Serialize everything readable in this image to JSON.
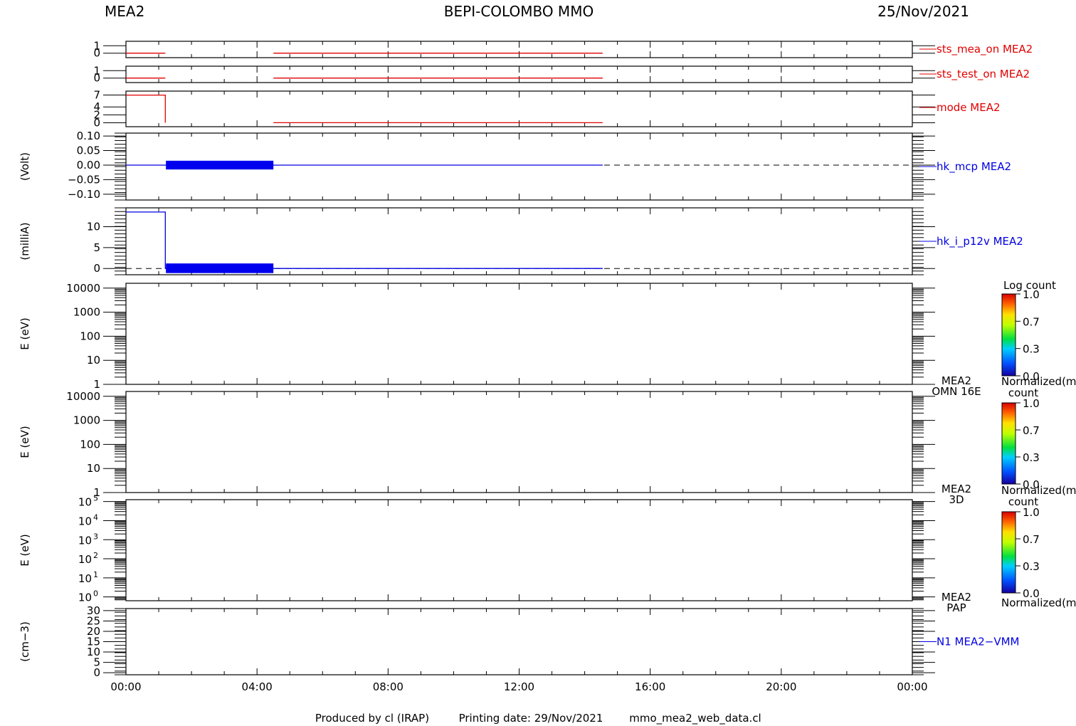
{
  "header": {
    "left": "MEA2",
    "center": "BEPI-COLOMBO MMO",
    "right": "25/Nov/2021"
  },
  "footer": {
    "produced": "Produced by cl (IRAP)",
    "printing": "Printing date: 29/Nov/2021",
    "file": "mmo_mea2_web_data.cl"
  },
  "colors": {
    "red_trace": "#e00000",
    "blue_trace": "#0000e0",
    "fill_blue": "#0000ee",
    "axis": "#000000"
  },
  "chart_data": [
    {
      "type": "line",
      "name": "sts_mea_on",
      "label": "sts_mea_on MEA2",
      "label_color": "red",
      "ylabel": "",
      "ylim": [
        -0.6,
        1.6
      ],
      "yticks": [
        {
          "v": 1,
          "t": "1"
        },
        {
          "v": 0,
          "t": "0"
        }
      ],
      "segments": [
        {
          "x": [
            0.0,
            1.2
          ],
          "y": [
            0,
            0
          ]
        },
        {
          "x": [
            4.5,
            14.55
          ],
          "y": [
            0,
            0
          ]
        }
      ]
    },
    {
      "type": "line",
      "name": "sts_test_on",
      "label": "sts_test_on MEA2",
      "label_color": "red",
      "ylabel": "",
      "ylim": [
        -0.6,
        1.6
      ],
      "yticks": [
        {
          "v": 1,
          "t": "1"
        },
        {
          "v": 0,
          "t": "0"
        }
      ],
      "segments": [
        {
          "x": [
            0.0,
            1.2
          ],
          "y": [
            0,
            0
          ]
        },
        {
          "x": [
            4.5,
            14.55
          ],
          "y": [
            0,
            0
          ]
        }
      ]
    },
    {
      "type": "line",
      "name": "mode",
      "label": "mode MEA2",
      "label_color": "red",
      "ylabel": "",
      "ylim": [
        -1,
        8
      ],
      "yticks": [
        {
          "v": 7,
          "t": "7"
        },
        {
          "v": 4,
          "t": "4"
        },
        {
          "v": 2,
          "t": "2"
        },
        {
          "v": 0,
          "t": "0"
        }
      ],
      "segments": [
        {
          "x": [
            0.0,
            1.2,
            1.2
          ],
          "y": [
            7,
            7,
            0
          ]
        },
        {
          "x": [
            4.5,
            14.55
          ],
          "y": [
            0,
            0
          ]
        }
      ]
    },
    {
      "type": "line",
      "name": "hk_mcp",
      "label": "hk_mcp MEA2",
      "label_color": "blue",
      "ylabel": "(Volt)",
      "ylim": [
        -0.12,
        0.11
      ],
      "yticks": [
        {
          "v": 0.1,
          "t": "0.10"
        },
        {
          "v": 0.05,
          "t": "0.05"
        },
        {
          "v": 0.0,
          "t": "0.00"
        },
        {
          "v": -0.05,
          "t": "−0.05"
        },
        {
          "v": -0.1,
          "t": "−0.10"
        }
      ],
      "zero_dashed": true,
      "filled_band": {
        "x": [
          1.22,
          4.5
        ],
        "y": [
          -0.015,
          0.015
        ]
      },
      "segments": [
        {
          "x": [
            0.0,
            14.55
          ],
          "y": [
            0,
            0
          ]
        }
      ]
    },
    {
      "type": "line",
      "name": "hk_i_p12v",
      "label": "hk_i_p12v MEA2",
      "label_color": "blue",
      "ylabel": "(milliA)",
      "ylim": [
        -1.5,
        14.5
      ],
      "yticks": [
        {
          "v": 10,
          "t": "10"
        },
        {
          "v": 5,
          "t": "5"
        },
        {
          "v": 0,
          "t": "0"
        }
      ],
      "zero_dashed": true,
      "filled_band": {
        "x": [
          1.22,
          4.5
        ],
        "y": [
          -1.1,
          1.2
        ]
      },
      "segments": [
        {
          "x": [
            0.0,
            1.2,
            1.2,
            14.55
          ],
          "y": [
            13.5,
            13.5,
            0,
            0
          ]
        }
      ]
    },
    {
      "type": "heatmap",
      "name": "omn",
      "label": [
        "MEA2",
        "OMN 16E"
      ],
      "ylabel": "E (eV)",
      "ylog": [
        0,
        4.2
      ],
      "yticks": [
        {
          "v": 4,
          "t": "10000"
        },
        {
          "v": 3,
          "t": "1000"
        },
        {
          "v": 2,
          "t": "100"
        },
        {
          "v": 1,
          "t": "10"
        },
        {
          "v": 0,
          "t": "1"
        }
      ],
      "colorbar": {
        "title": "Log count",
        "ticks": [
          "1.0",
          "0.7",
          "0.3",
          "0.0"
        ]
      }
    },
    {
      "type": "heatmap",
      "name": "3d",
      "label": [
        "MEA2",
        "3D"
      ],
      "ylabel": "E (eV)",
      "ylog": [
        0,
        4.2
      ],
      "yticks": [
        {
          "v": 4,
          "t": "10000"
        },
        {
          "v": 3,
          "t": "1000"
        },
        {
          "v": 2,
          "t": "100"
        },
        {
          "v": 1,
          "t": "10"
        },
        {
          "v": 0,
          "t": "1"
        }
      ],
      "colorbar": {
        "title": [
          "Normalized(m",
          "count"
        ],
        "ticks": [
          "1.0",
          "0.7",
          "0.3",
          "0.0"
        ]
      }
    },
    {
      "type": "heatmap",
      "name": "pap",
      "label": [
        "MEA2",
        "PAP"
      ],
      "ylabel": "E (eV)",
      "ylog": [
        -0.2,
        5.1
      ],
      "yticks": [
        {
          "v": 5,
          "t": "5"
        },
        {
          "v": 4,
          "t": "4"
        },
        {
          "v": 3,
          "t": "3"
        },
        {
          "v": 2,
          "t": "2"
        },
        {
          "v": 1,
          "t": "1"
        },
        {
          "v": 0,
          "t": "0"
        }
      ],
      "tick_base": "10",
      "colorbar": {
        "title": [
          "Normalized(m",
          "count"
        ],
        "ticks": [
          "1.0",
          "0.7",
          "0.3",
          "0.0"
        ]
      }
    },
    {
      "type": "line",
      "name": "n1",
      "label": "N1 MEA2−VMM",
      "label_color": "blue",
      "ylabel": "(cm−3)",
      "ylim": [
        -1,
        31
      ],
      "yticks": [
        {
          "v": 30,
          "t": "30"
        },
        {
          "v": 25,
          "t": "25"
        },
        {
          "v": 20,
          "t": "20"
        },
        {
          "v": 15,
          "t": "15"
        },
        {
          "v": 10,
          "t": "10"
        },
        {
          "v": 5,
          "t": "5"
        },
        {
          "v": 0,
          "t": "0"
        }
      ],
      "segments": []
    }
  ],
  "colorbar_bottom_label": "Normalized(m",
  "x_axis": {
    "unit": "hours",
    "xlim": [
      0,
      24
    ],
    "ticks": [
      {
        "v": 0,
        "t": "00:00"
      },
      {
        "v": 4,
        "t": "04:00"
      },
      {
        "v": 8,
        "t": "08:00"
      },
      {
        "v": 12,
        "t": "12:00"
      },
      {
        "v": 16,
        "t": "16:00"
      },
      {
        "v": 20,
        "t": "20:00"
      },
      {
        "v": 24,
        "t": "00:00"
      }
    ]
  }
}
